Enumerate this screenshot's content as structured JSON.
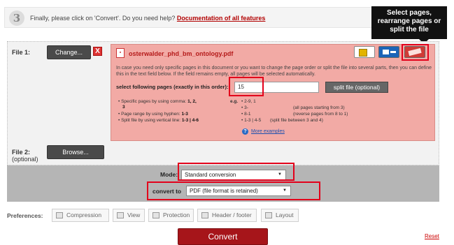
{
  "step": {
    "number": "3",
    "text": "Finally, please click on 'Convert'. Do you need help?",
    "link": "Documentation of all features"
  },
  "tooltip": {
    "line1": "Select pages,",
    "line2": "rearrange pages or",
    "line3": "split the file"
  },
  "file1": {
    "label": "File 1:",
    "change_label": "Change...",
    "delete_glyph": "X",
    "filename": "osterwalder_phd_bm_ontology.pdf",
    "info": "In case you need only specific pages in this document or you want to change the page order or split the file into several parts, then you can define this in the text field below. If the field remains empty, all pages will be selected automatically.",
    "select_label": "select following pages (exactly in this order):",
    "pages_value": "15",
    "split_label": "split file (optional)",
    "rules": [
      {
        "prefix": "Specific pages by using comma:",
        "example": "1, 2,",
        "cont": "3"
      },
      {
        "prefix": "Page range by using hyphen:",
        "example": "1-3"
      },
      {
        "prefix": "Split file by using vertical line:",
        "example": "1-3 | 4-6"
      }
    ],
    "eg": "e.g.",
    "examples": [
      {
        "code": "2-9, 1",
        "desc": ""
      },
      {
        "code": "3-",
        "desc": "(all pages starting from 3)"
      },
      {
        "code": "8-1",
        "desc": "(reverse pages from 8 to 1)"
      },
      {
        "code": "1-3 | 4-5",
        "desc": "(split file between 3 and 4)"
      }
    ],
    "help_glyph": "?",
    "more_examples": "More examples"
  },
  "file2": {
    "label": "File 2:",
    "sub": "(optional)",
    "browse_label": "Browse..."
  },
  "mode": {
    "label": "Mode:",
    "value": "Standard conversion"
  },
  "convert_to": {
    "label": "convert to",
    "value": "PDF (file format is retained)"
  },
  "preferences": {
    "label": "Preferences:",
    "items": [
      "Compression",
      "View",
      "Protection",
      "Header / footer",
      "Layout"
    ]
  },
  "convert_label": "Convert",
  "reset_label": "Reset",
  "colors": {
    "accent_red": "#a6151a",
    "panel_pink": "#f2aaa5",
    "highlight": "#e3001b"
  }
}
